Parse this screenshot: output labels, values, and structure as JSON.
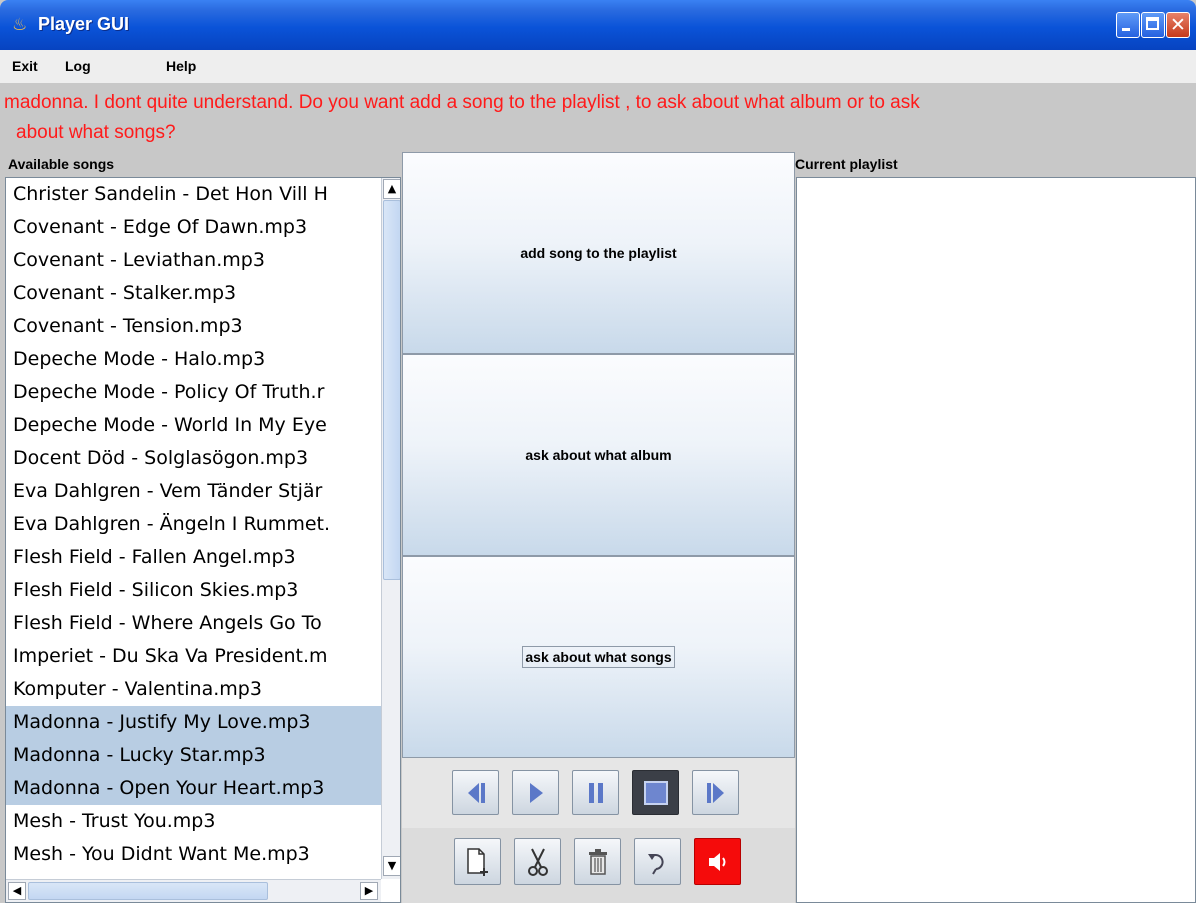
{
  "window": {
    "title": "Player GUI"
  },
  "menu": {
    "items": [
      "Exit",
      "Log",
      "Help"
    ]
  },
  "message": {
    "line1": "madonna. I dont quite understand.  Do you want  add a song to the playlist , to ask about what album or to ask",
    "line2": "about what songs?",
    "color": "#ff1a1a"
  },
  "left_panel": {
    "label": "Available songs",
    "songs": [
      "Christer Sandelin - Det Hon Vill H",
      "Covenant - Edge Of Dawn.mp3",
      "Covenant - Leviathan.mp3",
      "Covenant - Stalker.mp3",
      "Covenant - Tension.mp3",
      "Depeche Mode - Halo.mp3",
      "Depeche Mode - Policy Of Truth.r",
      "Depeche Mode - World In My Eye",
      "Docent Död - Solglasögon.mp3",
      "Eva Dahlgren - Vem Tänder Stjär",
      "Eva Dahlgren - Ängeln I Rummet.",
      "Flesh Field - Fallen Angel.mp3",
      "Flesh Field - Silicon Skies.mp3",
      "Flesh Field - Where Angels Go To",
      "Imperiet - Du Ska Va President.m",
      "Komputer - Valentina.mp3",
      "Madonna - Justify My Love.mp3",
      "Madonna - Lucky Star.mp3",
      "Madonna - Open Your Heart.mp3",
      "Mesh - Trust You.mp3",
      "Mesh - You Didnt Want Me.mp3"
    ],
    "selected": [
      16,
      17,
      18
    ],
    "selection_color": "#b8cde3"
  },
  "center_panel": {
    "buttons": [
      "add song to the playlist",
      "ask about what album",
      "ask about what songs"
    ],
    "playback_controls": [
      "previous-icon",
      "play-icon",
      "pause-icon",
      "stop-icon",
      "next-icon"
    ],
    "edit_controls": [
      "new-file-icon",
      "scissors-icon",
      "trash-icon",
      "repeat-icon",
      "speaker-icon"
    ]
  },
  "right_panel": {
    "label": "Current playlist"
  }
}
